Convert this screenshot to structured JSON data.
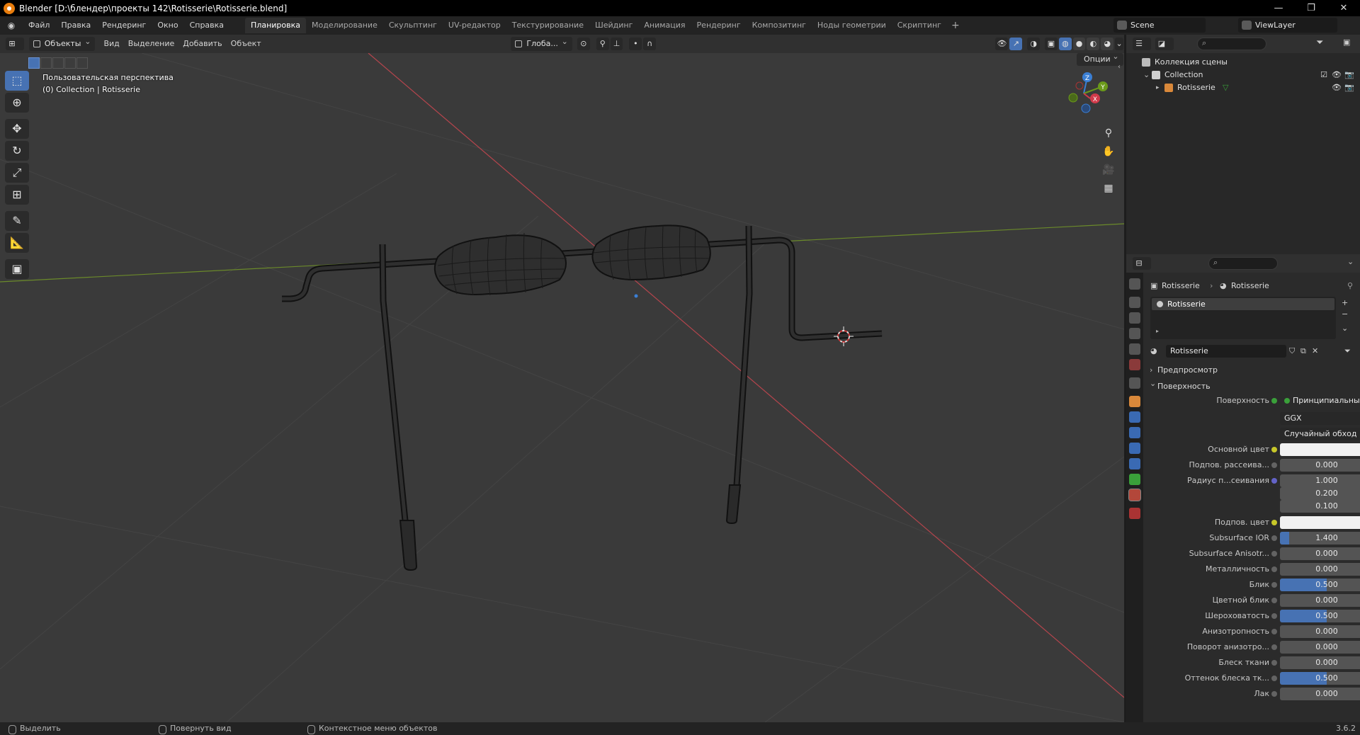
{
  "window": {
    "title": "Blender [D:\\блендер\\проекты 142\\Rotisserie\\Rotisserie.blend]",
    "minimize": "—",
    "maximize": "❐",
    "close": "✕"
  },
  "menu": {
    "items": [
      "Файл",
      "Правка",
      "Рендеринг",
      "Окно",
      "Справка"
    ]
  },
  "workspaces": {
    "tabs": [
      "Планировка",
      "Моделирование",
      "Скульптинг",
      "UV-редактор",
      "Текстурирование",
      "Шейдинг",
      "Анимация",
      "Рендеринг",
      "Композитинг",
      "Ноды геометрии",
      "Скриптинг"
    ],
    "active_index": 0,
    "add": "+"
  },
  "scene": {
    "name": "Scene"
  },
  "view_layer": {
    "name": "ViewLayer"
  },
  "viewport_header": {
    "mode": "Объекты",
    "menus": [
      "Вид",
      "Выделение",
      "Добавить",
      "Объект"
    ],
    "orientation": "Глоба...",
    "options": "Опции"
  },
  "viewport": {
    "view_name": "Пользовательская перспектива",
    "collection_info": "(0) Collection | Rotisserie",
    "gizmo": {
      "z": "Z",
      "y": "Y",
      "x": "X"
    },
    "colors": {
      "background": "#3a3a3a",
      "grid": "#454545",
      "x_axis": "#b5454d",
      "y_axis": "#6b8a2a",
      "wire": "#151515"
    }
  },
  "toolbar": {
    "tools": [
      "select-box",
      "cursor",
      "move",
      "rotate",
      "scale",
      "transform",
      "annotate",
      "measure",
      "add-cube"
    ],
    "active": "select-box"
  },
  "outliner": {
    "root": "Коллекция сцены",
    "collection": "Collection",
    "object": "Rotisserie"
  },
  "properties": {
    "breadcrumb": {
      "object": "Rotisserie",
      "material": "Rotisserie"
    },
    "slot": "Rotisserie",
    "material_name": "Rotisserie",
    "panels": {
      "preview": "Предпросмотр",
      "surface": "Поверхность"
    },
    "rows": [
      {
        "label": "Поверхность",
        "type": "link",
        "value": "Принципиальный BSDF",
        "dot": "green"
      },
      {
        "label": "",
        "type": "drop",
        "value": "GGX",
        "dot": ""
      },
      {
        "label": "",
        "type": "drop",
        "value": "Случайный обход",
        "dot": ""
      },
      {
        "label": "Основной цвет",
        "type": "color",
        "value": "",
        "dot": "yellow"
      },
      {
        "label": "Подпов. рассеива...",
        "type": "num",
        "value": "0.000",
        "dot": "gray",
        "fill": 0
      },
      {
        "label": "Радиус п...сеивания",
        "type": "num",
        "value": "1.000",
        "dot": "purple",
        "fill": 0
      },
      {
        "label": "",
        "type": "num",
        "value": "0.200",
        "dot": "",
        "fill": 0
      },
      {
        "label": "",
        "type": "num",
        "value": "0.100",
        "dot": "",
        "fill": 0
      },
      {
        "label": "Подпов. цвет",
        "type": "color",
        "value": "",
        "dot": "yellow"
      },
      {
        "label": "Subsurface IOR",
        "type": "num",
        "value": "1.400",
        "dot": "gray",
        "fill": 0.1
      },
      {
        "label": "Subsurface Anisotr...",
        "type": "num",
        "value": "0.000",
        "dot": "gray",
        "fill": 0
      },
      {
        "label": "Металличность",
        "type": "num",
        "value": "0.000",
        "dot": "gray",
        "fill": 0
      },
      {
        "label": "Блик",
        "type": "num",
        "value": "0.500",
        "dot": "gray",
        "fill": 0.5
      },
      {
        "label": "Цветной блик",
        "type": "num",
        "value": "0.000",
        "dot": "gray",
        "fill": 0
      },
      {
        "label": "Шероховатость",
        "type": "num",
        "value": "0.500",
        "dot": "gray",
        "fill": 0.5
      },
      {
        "label": "Анизотропность",
        "type": "num",
        "value": "0.000",
        "dot": "gray",
        "fill": 0
      },
      {
        "label": "Поворот анизотро...",
        "type": "num",
        "value": "0.000",
        "dot": "gray",
        "fill": 0
      },
      {
        "label": "Блеск ткани",
        "type": "num",
        "value": "0.000",
        "dot": "gray",
        "fill": 0
      },
      {
        "label": "Оттенок блеска тк...",
        "type": "num",
        "value": "0.500",
        "dot": "gray",
        "fill": 0.5
      },
      {
        "label": "Лак",
        "type": "num",
        "value": "0.000",
        "dot": "gray",
        "fill": 0
      }
    ]
  },
  "statusbar": {
    "select": "Выделить",
    "rotate_view": "Повернуть вид",
    "context_menu": "Контекстное меню объектов",
    "version": "3.6.2"
  }
}
